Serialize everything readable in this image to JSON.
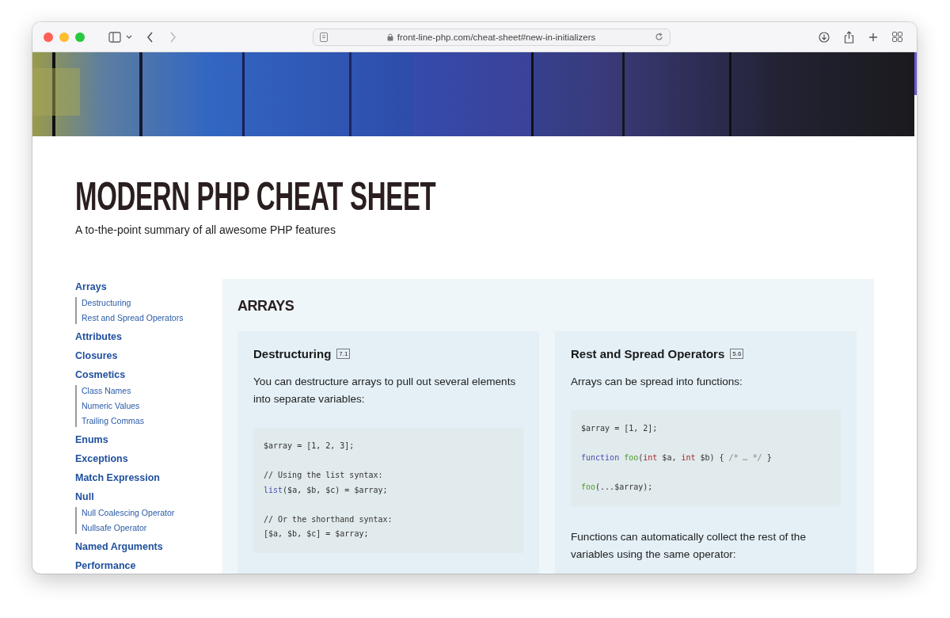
{
  "browser": {
    "url": "front-line-php.com/cheat-sheet#new-in-initializers"
  },
  "header": {
    "title": "MODERN PHP CHEAT SHEET",
    "subtitle": "A to-the-point summary of all awesome PHP features"
  },
  "sidebar": {
    "items": [
      {
        "label": "Arrays",
        "children": [
          {
            "label": "Destructuring"
          },
          {
            "label": "Rest and Spread Operators"
          }
        ]
      },
      {
        "label": "Attributes"
      },
      {
        "label": "Closures"
      },
      {
        "label": "Cosmetics",
        "children": [
          {
            "label": "Class Names"
          },
          {
            "label": "Numeric Values"
          },
          {
            "label": "Trailing Commas"
          }
        ]
      },
      {
        "label": "Enums"
      },
      {
        "label": "Exceptions"
      },
      {
        "label": "Match Expression"
      },
      {
        "label": "Null",
        "children": [
          {
            "label": "Null Coalescing Operator"
          },
          {
            "label": "Nullsafe Operator"
          }
        ]
      },
      {
        "label": "Named Arguments"
      },
      {
        "label": "Performance"
      }
    ]
  },
  "section": {
    "title": "ARRAYS",
    "cards": [
      {
        "title": "Destructuring",
        "version": "7.1",
        "blocks": [
          {
            "kind": "text",
            "text": "You can destructure arrays to pull out several elements into separate variables:"
          },
          {
            "kind": "code",
            "lines": [
              {
                "kind": "code",
                "tokens": [
                  {
                    "kind": "plain",
                    "text": "$array = [1, 2, 3];"
                  }
                ]
              },
              {
                "kind": "blank"
              },
              {
                "kind": "code",
                "tokens": [
                  {
                    "kind": "plain",
                    "text": "// Using the list syntax:"
                  }
                ]
              },
              {
                "kind": "code",
                "tokens": [
                  {
                    "kind": "keyword",
                    "text": "list"
                  },
                  {
                    "kind": "plain",
                    "text": "($a, $b, $c) = $array;"
                  }
                ]
              },
              {
                "kind": "blank"
              },
              {
                "kind": "code",
                "tokens": [
                  {
                    "kind": "plain",
                    "text": "// Or the shorthand syntax:"
                  }
                ]
              },
              {
                "kind": "code",
                "tokens": [
                  {
                    "kind": "plain",
                    "text": "[$a, $b, $c] = $array;"
                  }
                ]
              }
            ]
          }
        ]
      },
      {
        "title": "Rest and Spread Operators",
        "version": "5.6",
        "blocks": [
          {
            "kind": "text",
            "text": "Arrays can be spread into functions:"
          },
          {
            "kind": "code",
            "lines": [
              {
                "kind": "code",
                "tokens": [
                  {
                    "kind": "plain",
                    "text": "$array = [1, 2];"
                  }
                ]
              },
              {
                "kind": "blank"
              },
              {
                "kind": "code",
                "tokens": [
                  {
                    "kind": "keyword",
                    "text": "function "
                  },
                  {
                    "kind": "function",
                    "text": "foo"
                  },
                  {
                    "kind": "plain",
                    "text": "("
                  },
                  {
                    "kind": "type",
                    "text": "int"
                  },
                  {
                    "kind": "plain",
                    "text": " $a, "
                  },
                  {
                    "kind": "type",
                    "text": "int"
                  },
                  {
                    "kind": "plain",
                    "text": " $b) { "
                  },
                  {
                    "kind": "comment",
                    "text": "/* … */"
                  },
                  {
                    "kind": "plain",
                    "text": " }"
                  }
                ]
              },
              {
                "kind": "blank"
              },
              {
                "kind": "code",
                "tokens": [
                  {
                    "kind": "function",
                    "text": "foo"
                  },
                  {
                    "kind": "plain",
                    "text": "(...$array);"
                  }
                ]
              }
            ]
          },
          {
            "kind": "text",
            "text": "Functions can automatically collect the rest of the variables using the same operator:"
          }
        ]
      }
    ]
  }
}
